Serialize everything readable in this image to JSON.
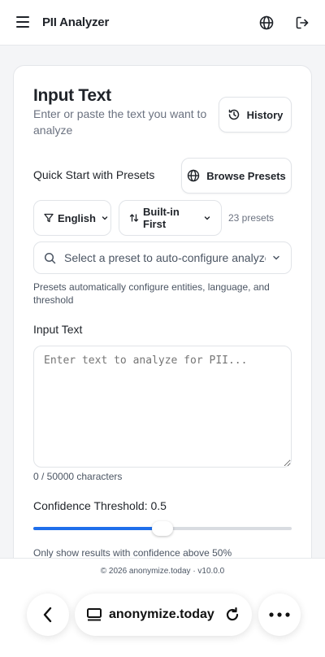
{
  "header": {
    "app_title": "PII Analyzer",
    "menu_icon": "hamburger-menu-icon",
    "language_icon": "globe-icon",
    "logout_icon": "logout-icon"
  },
  "card": {
    "title": "Input Text",
    "subtitle": "Enter or paste the text you want to analyze",
    "history_label": "History",
    "quick_start_label": "Quick Start with Presets",
    "browse_presets_label": "Browse Presets",
    "language_filter": "English",
    "sort_filter": "Built-in First",
    "presets_count": "23 presets",
    "preset_select_placeholder": "Select a preset to auto-configure analyzer...",
    "presets_helper": "Presets automatically configure entities, language, and threshold",
    "input_label": "Input Text",
    "input_placeholder": "Enter text to analyze for PII...",
    "input_value": "",
    "char_count": "0 / 50000 characters",
    "confidence_label": "Confidence Threshold: 0.5",
    "confidence_value": 0.5,
    "confidence_helper": "Only show results with confidence above 50%"
  },
  "footer": {
    "text": "© 2026 anonymize.today · v10.0.0"
  },
  "browser": {
    "url": "anonymize.today",
    "back_icon": "chevron-left-icon",
    "tabs_icon": "tabs-icon",
    "reload_icon": "reload-icon",
    "more_icon": "more-dots-icon"
  },
  "colors": {
    "accent": "#1f6feb",
    "text": "#1f2329",
    "muted": "#6b7280",
    "background": "#f4f5f7"
  }
}
